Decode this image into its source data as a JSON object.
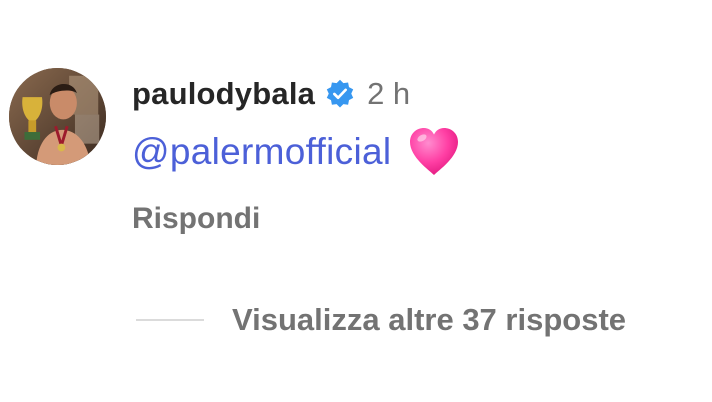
{
  "comment": {
    "author": {
      "username": "paulodybala",
      "verified": true,
      "avatar_icon": "user-avatar-photo"
    },
    "timestamp": "2 h",
    "mention": "@palermofficial",
    "emoji_icon": "pink-heart-emoji",
    "reply_label": "Rispondi",
    "view_replies_label": "Visualizza altre 37 risposte"
  },
  "colors": {
    "text_primary": "#262626",
    "text_secondary": "#737373",
    "mention": "#4c60d8",
    "verified_badge": "#3797f0",
    "heart": "#ff2f92",
    "divider": "#dbdbdb"
  }
}
